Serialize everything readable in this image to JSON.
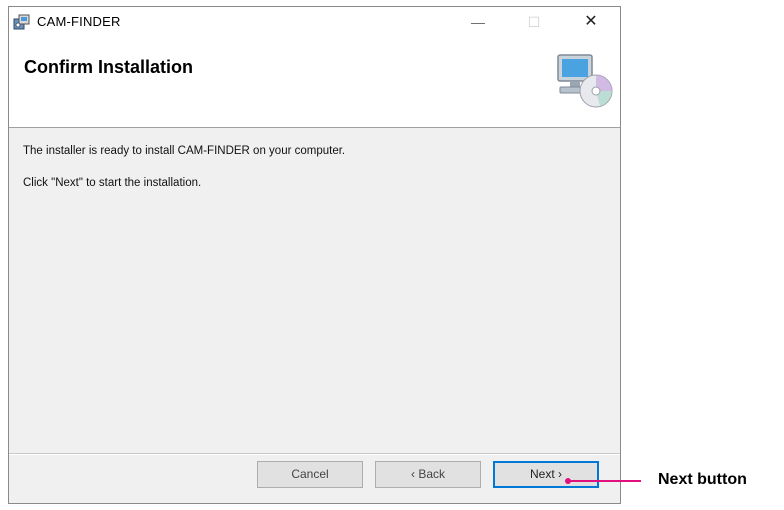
{
  "window": {
    "title": "CAM-FINDER",
    "minimize_glyph": "—",
    "maximize_glyph": "☐",
    "close_glyph": "✕"
  },
  "header": {
    "title": "Confirm Installation",
    "icon": "computer-cd-icon"
  },
  "body": {
    "line1": "The installer is ready to install CAM-FINDER on your computer.",
    "line2": "Click \"Next\" to start the installation."
  },
  "buttons": {
    "cancel": "Cancel",
    "back": "‹ Back",
    "next": "Next ›"
  },
  "annotation": {
    "label": "Next button",
    "color": "#e0107e"
  },
  "colors": {
    "accent": "#0078d7",
    "window_bg": "#f0f0f0"
  }
}
